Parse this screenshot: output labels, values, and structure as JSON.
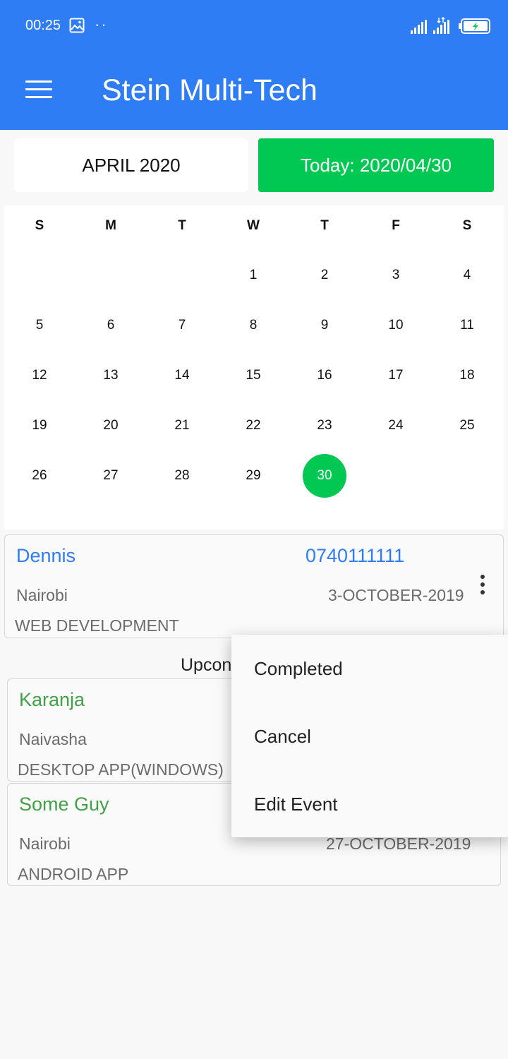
{
  "status": {
    "time": "00:25"
  },
  "app": {
    "title": "Stein Multi-Tech"
  },
  "calendar": {
    "month_label": "APRIL 2020",
    "today_label": "Today: 2020/04/30",
    "weekdays": [
      "S",
      "M",
      "T",
      "W",
      "T",
      "F",
      "S"
    ],
    "days": [
      "1",
      "2",
      "3",
      "4",
      "5",
      "6",
      "7",
      "8",
      "9",
      "10",
      "11",
      "12",
      "13",
      "14",
      "15",
      "16",
      "17",
      "18",
      "19",
      "20",
      "21",
      "22",
      "23",
      "24",
      "25",
      "26",
      "27",
      "28",
      "29",
      "30"
    ],
    "selected_day": "30",
    "accent_color": "#00c853",
    "brand_color": "#2f7df4"
  },
  "current_event": {
    "name": "Dennis",
    "phone": "0740111111",
    "city": "Nairobi",
    "date": "3-OCTOBER-2019",
    "type": "WEB DEVELOPMENT"
  },
  "upcoming_label": "Upcon",
  "upcoming_events": [
    {
      "name": "Karanja",
      "city": "Naivasha",
      "type": "DESKTOP APP(WINDOWS)"
    },
    {
      "name": "Some Guy",
      "city": "Nairobi",
      "date": "27-OCTOBER-2019",
      "type": "ANDROID APP"
    }
  ],
  "context_menu": {
    "items": [
      "Completed",
      "Cancel",
      "Edit Event"
    ]
  }
}
